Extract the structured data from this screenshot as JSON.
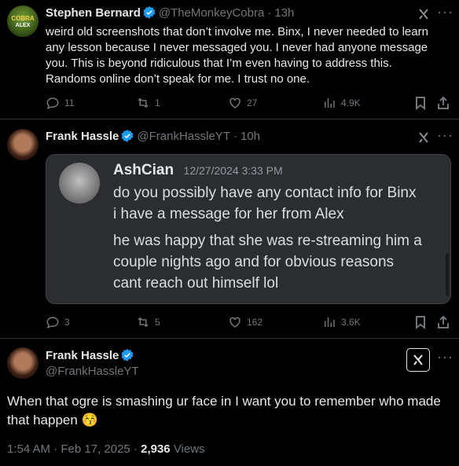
{
  "tweet1": {
    "display_name": "Stephen Bernard",
    "handle": "@TheMonkeyCobra",
    "separator": "·",
    "time": "13h",
    "avatar_text_top": "COBRA",
    "avatar_text_bottom": "ALEX",
    "lines": [
      "weird old screenshots that don’t involve me. Binx, I never needed to learn",
      "any lesson because I never messaged you. I never had anyone message",
      "you.  This is beyond ridiculous that I’m even having to address this.",
      "Randoms online don’t speak for me. I trust no one."
    ],
    "replies": "11",
    "reposts": "1",
    "likes": "27",
    "views": "4.9K"
  },
  "tweet2": {
    "display_name": "Frank Hassle",
    "handle": "@FrankHassleYT",
    "separator": "·",
    "time": "10h",
    "replies": "3",
    "reposts": "5",
    "likes": "162",
    "views": "3.6K",
    "embed": {
      "author": "AshCian",
      "timestamp": "12/27/2024 3:33 PM",
      "lines": [
        "do you possibly have any contact info for Binx",
        "i have a message for her from Alex",
        "he was happy that she was re-streaming him a",
        "couple nights ago and for obvious reasons",
        "cant reach out himself lol"
      ]
    }
  },
  "tweet3": {
    "display_name": "Frank Hassle",
    "handle": "@FrankHassleYT",
    "line1": "When that ogre is smashing ur face in I want you to remember who made",
    "line2": "that happen",
    "emoji": "😚",
    "time": "1:54 AM · Feb 17, 2025 · ",
    "views_count": "2,936",
    "views_label": " Views"
  },
  "colors": {
    "background": "#000000",
    "text": "#e7e9ea",
    "muted": "#71767b",
    "verified": "#1d9bf0",
    "embed_bg": "#2b2d31"
  }
}
